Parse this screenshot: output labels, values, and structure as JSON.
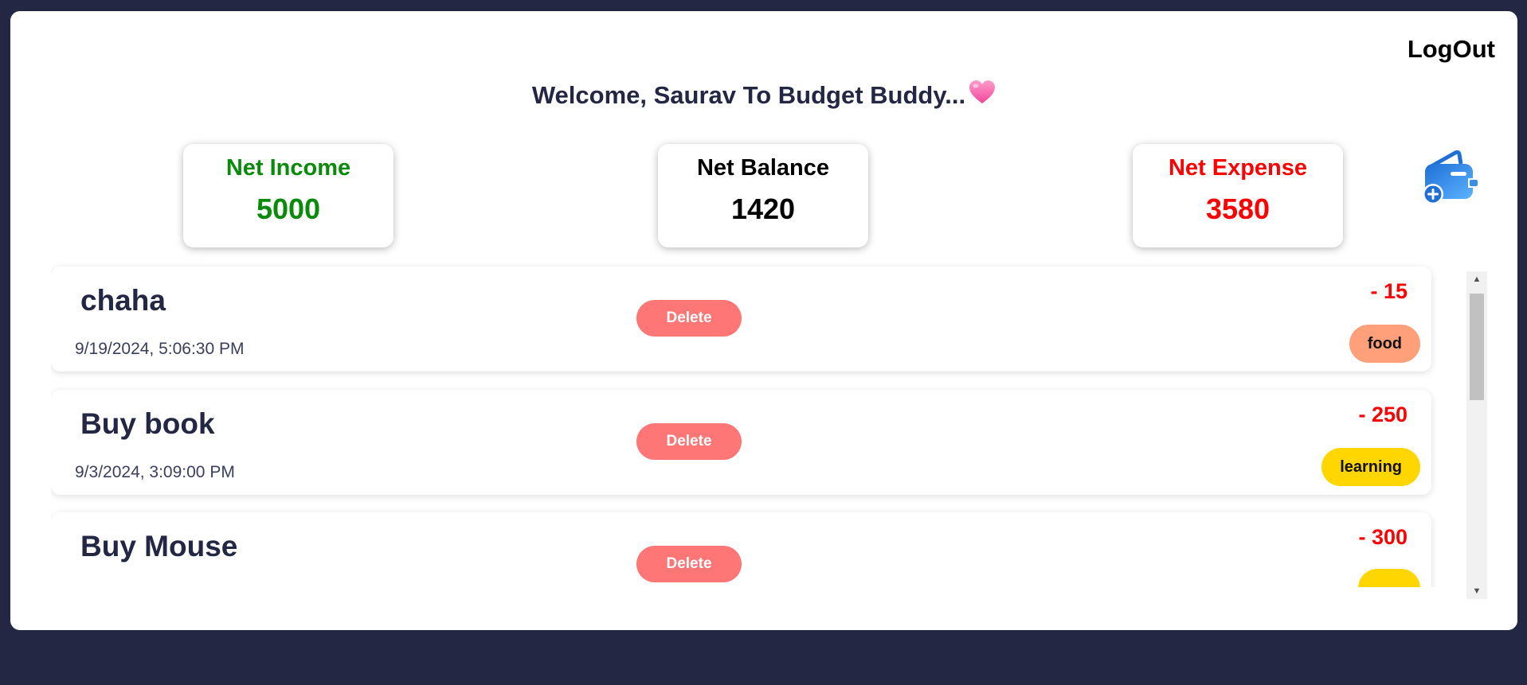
{
  "header": {
    "logout_label": "LogOut",
    "welcome_text": "Welcome, Saurav To Budget Buddy..."
  },
  "summary": {
    "income": {
      "label": "Net Income",
      "value": "5000"
    },
    "balance": {
      "label": "Net Balance",
      "value": "1420"
    },
    "expense": {
      "label": "Net Expense",
      "value": "3580"
    }
  },
  "transactions": [
    {
      "name": "chaha",
      "date": "9/19/2024, 5:06:30 PM",
      "amount": "- 15",
      "category": "food",
      "delete_label": "Delete"
    },
    {
      "name": "Buy book",
      "date": "9/3/2024, 3:09:00 PM",
      "amount": "- 250",
      "category": "learning",
      "delete_label": "Delete"
    },
    {
      "name": "Buy Mouse",
      "date": "",
      "amount": "- 300",
      "category": "",
      "delete_label": "Delete"
    }
  ],
  "colors": {
    "background": "#232744",
    "income": "#0a8a0a",
    "expense": "#ff0000",
    "delete_button": "#ff7676",
    "tag_food": "#ffa07a",
    "tag_learning": "#ffd600",
    "add_icon": "#2f8ded"
  },
  "icons": {
    "welcome": "heart-icon",
    "add": "add-wallet-icon"
  }
}
